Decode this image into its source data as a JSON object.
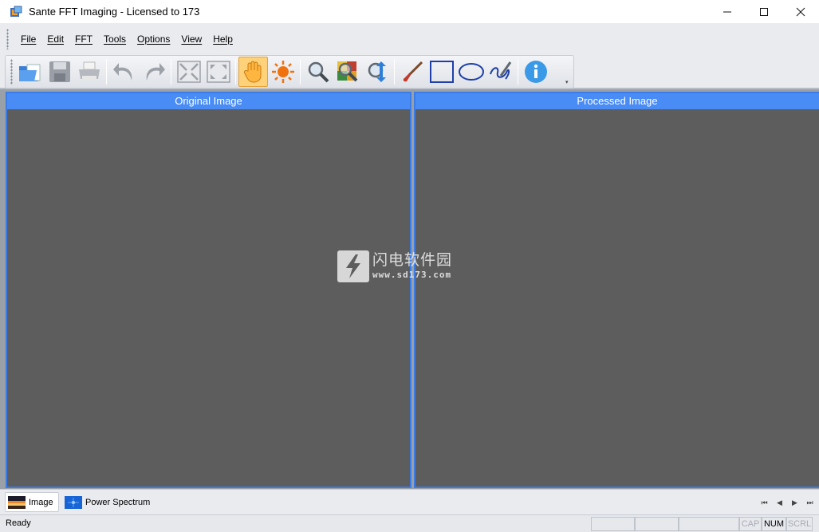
{
  "window": {
    "title": "Sante FFT Imaging - Licensed to 173",
    "minimize_glyph": "—",
    "maximize_glyph": "☐",
    "close_glyph": "✕"
  },
  "menu": [
    "File",
    "Edit",
    "FFT",
    "Tools",
    "Options",
    "View",
    "Help"
  ],
  "toolbar": {
    "buttons": [
      "open-icon",
      "save-icon",
      "print-icon",
      "undo-icon",
      "redo-icon",
      "fit-window-icon",
      "actual-size-icon",
      "hand-pan-icon",
      "brightness-icon",
      "zoom-icon",
      "magnify-region-icon",
      "zoom-updown-icon",
      "brush-icon",
      "rectangle-icon",
      "ellipse-icon",
      "freehand-icon",
      "info-icon"
    ],
    "active_tool": "hand-pan-icon",
    "overflow_glyph": "▾"
  },
  "panes": {
    "original": {
      "title": "Original Image"
    },
    "processed": {
      "title": "Processed Image"
    }
  },
  "watermark": {
    "chinese": "闪电软件园",
    "url": "www.sd173.com"
  },
  "tabs": [
    {
      "label": "Image",
      "active": true
    },
    {
      "label": "Power Spectrum",
      "active": false
    }
  ],
  "nav": {
    "first": "⏮",
    "prev": "◀",
    "next": "▶",
    "last": "⏭"
  },
  "status": {
    "text": "Ready",
    "cap": "CAP",
    "num": "NUM",
    "scrl": "SCRL"
  },
  "colors": {
    "accent": "#4a8cf5",
    "pane_border": "#3a7de8",
    "pane_bg": "#5d5d5d",
    "active_tool_bg": "#ffd27a"
  }
}
